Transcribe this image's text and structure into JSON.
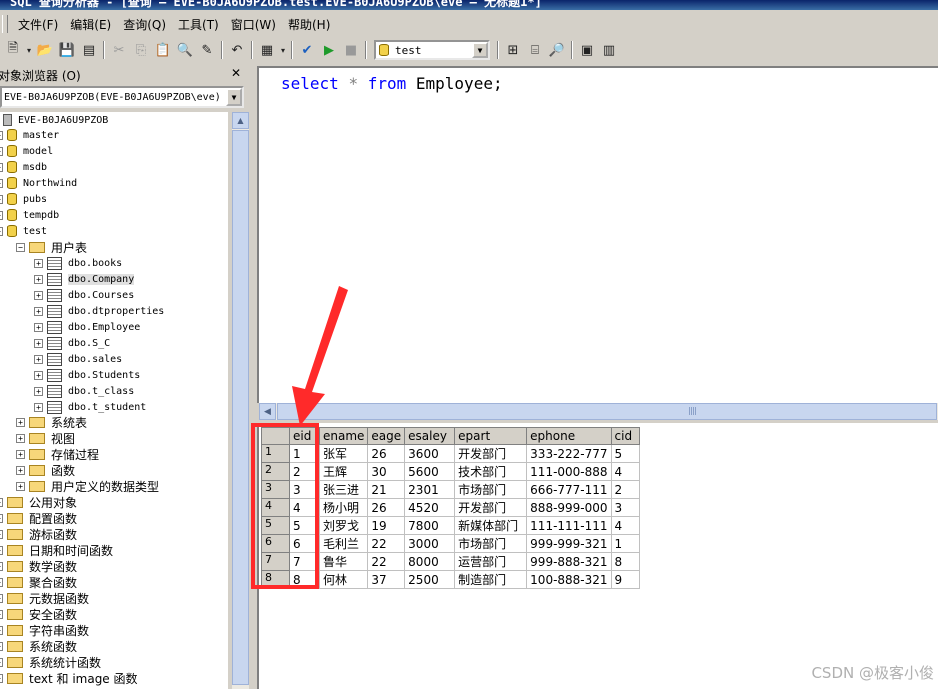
{
  "window": {
    "title": "SQL 查询分析器 - [查询 — EVE-B0JA6U9PZOB.test.EVE-B0JA6U9PZOB\\eve — 无标题1*]"
  },
  "menu": [
    "文件(F)",
    "编辑(E)",
    "查询(Q)",
    "工具(T)",
    "窗口(W)",
    "帮助(H)"
  ],
  "toolbar": {
    "database": "test"
  },
  "object_browser": {
    "title": "对象浏览器 (O)",
    "close": "✕",
    "server_combo": "EVE-B0JA6U9PZOB(EVE-B0JA6U9PZOB\\eve)",
    "server": "EVE-B0JA6U9PZOB",
    "databases": [
      "master",
      "model",
      "msdb",
      "Northwind",
      "pubs",
      "tempdb",
      "test"
    ],
    "user_tables_folder": "用户表",
    "tables": [
      "dbo.books",
      "dbo.Company",
      "dbo.Courses",
      "dbo.dtproperties",
      "dbo.Employee",
      "dbo.S_C",
      "dbo.sales",
      "dbo.Students",
      "dbo.t_class",
      "dbo.t_student"
    ],
    "test_folders": [
      "系统表",
      "视图",
      "存储过程",
      "函数",
      "用户定义的数据类型"
    ],
    "common_objects": "公用对象",
    "common_folders": [
      "配置函数",
      "游标函数",
      "日期和时间函数",
      "数学函数",
      "聚合函数",
      "元数据函数",
      "安全函数",
      "字符串函数",
      "系统函数",
      "系统统计函数",
      "text 和 image 函数"
    ]
  },
  "editor": {
    "kw_select": "select",
    "star": "*",
    "kw_from": "from",
    "table": "Employee;"
  },
  "results": {
    "columns": [
      "eid",
      "ename",
      "eage",
      "esaley",
      "epart",
      "ephone",
      "cid"
    ],
    "rows": [
      [
        "1",
        "1",
        "张军",
        "26",
        "3600",
        "开发部门",
        "333-222-777",
        "5"
      ],
      [
        "2",
        "2",
        "王辉",
        "30",
        "5600",
        "技术部门",
        "111-000-888",
        "4"
      ],
      [
        "3",
        "3",
        "张三进",
        "21",
        "2301",
        "市场部门",
        "666-777-111",
        "2"
      ],
      [
        "4",
        "4",
        "杨小明",
        "26",
        "4520",
        "开发部门",
        "888-999-000",
        "3"
      ],
      [
        "5",
        "5",
        "刘罗戈",
        "19",
        "7800",
        "新媒体部门",
        "111-111-111",
        "4"
      ],
      [
        "6",
        "6",
        "毛利兰",
        "22",
        "3000",
        "市场部门",
        "999-999-321",
        "1"
      ],
      [
        "7",
        "7",
        "鲁华",
        "22",
        "8000",
        "运营部门",
        "999-888-321",
        "8"
      ],
      [
        "8",
        "8",
        "何林",
        "37",
        "2500",
        "制造部门",
        "100-888-321",
        "9"
      ]
    ]
  },
  "annotation": {
    "highlight_color": "#ff2a2a"
  },
  "watermark": "CSDN @极客小俊"
}
